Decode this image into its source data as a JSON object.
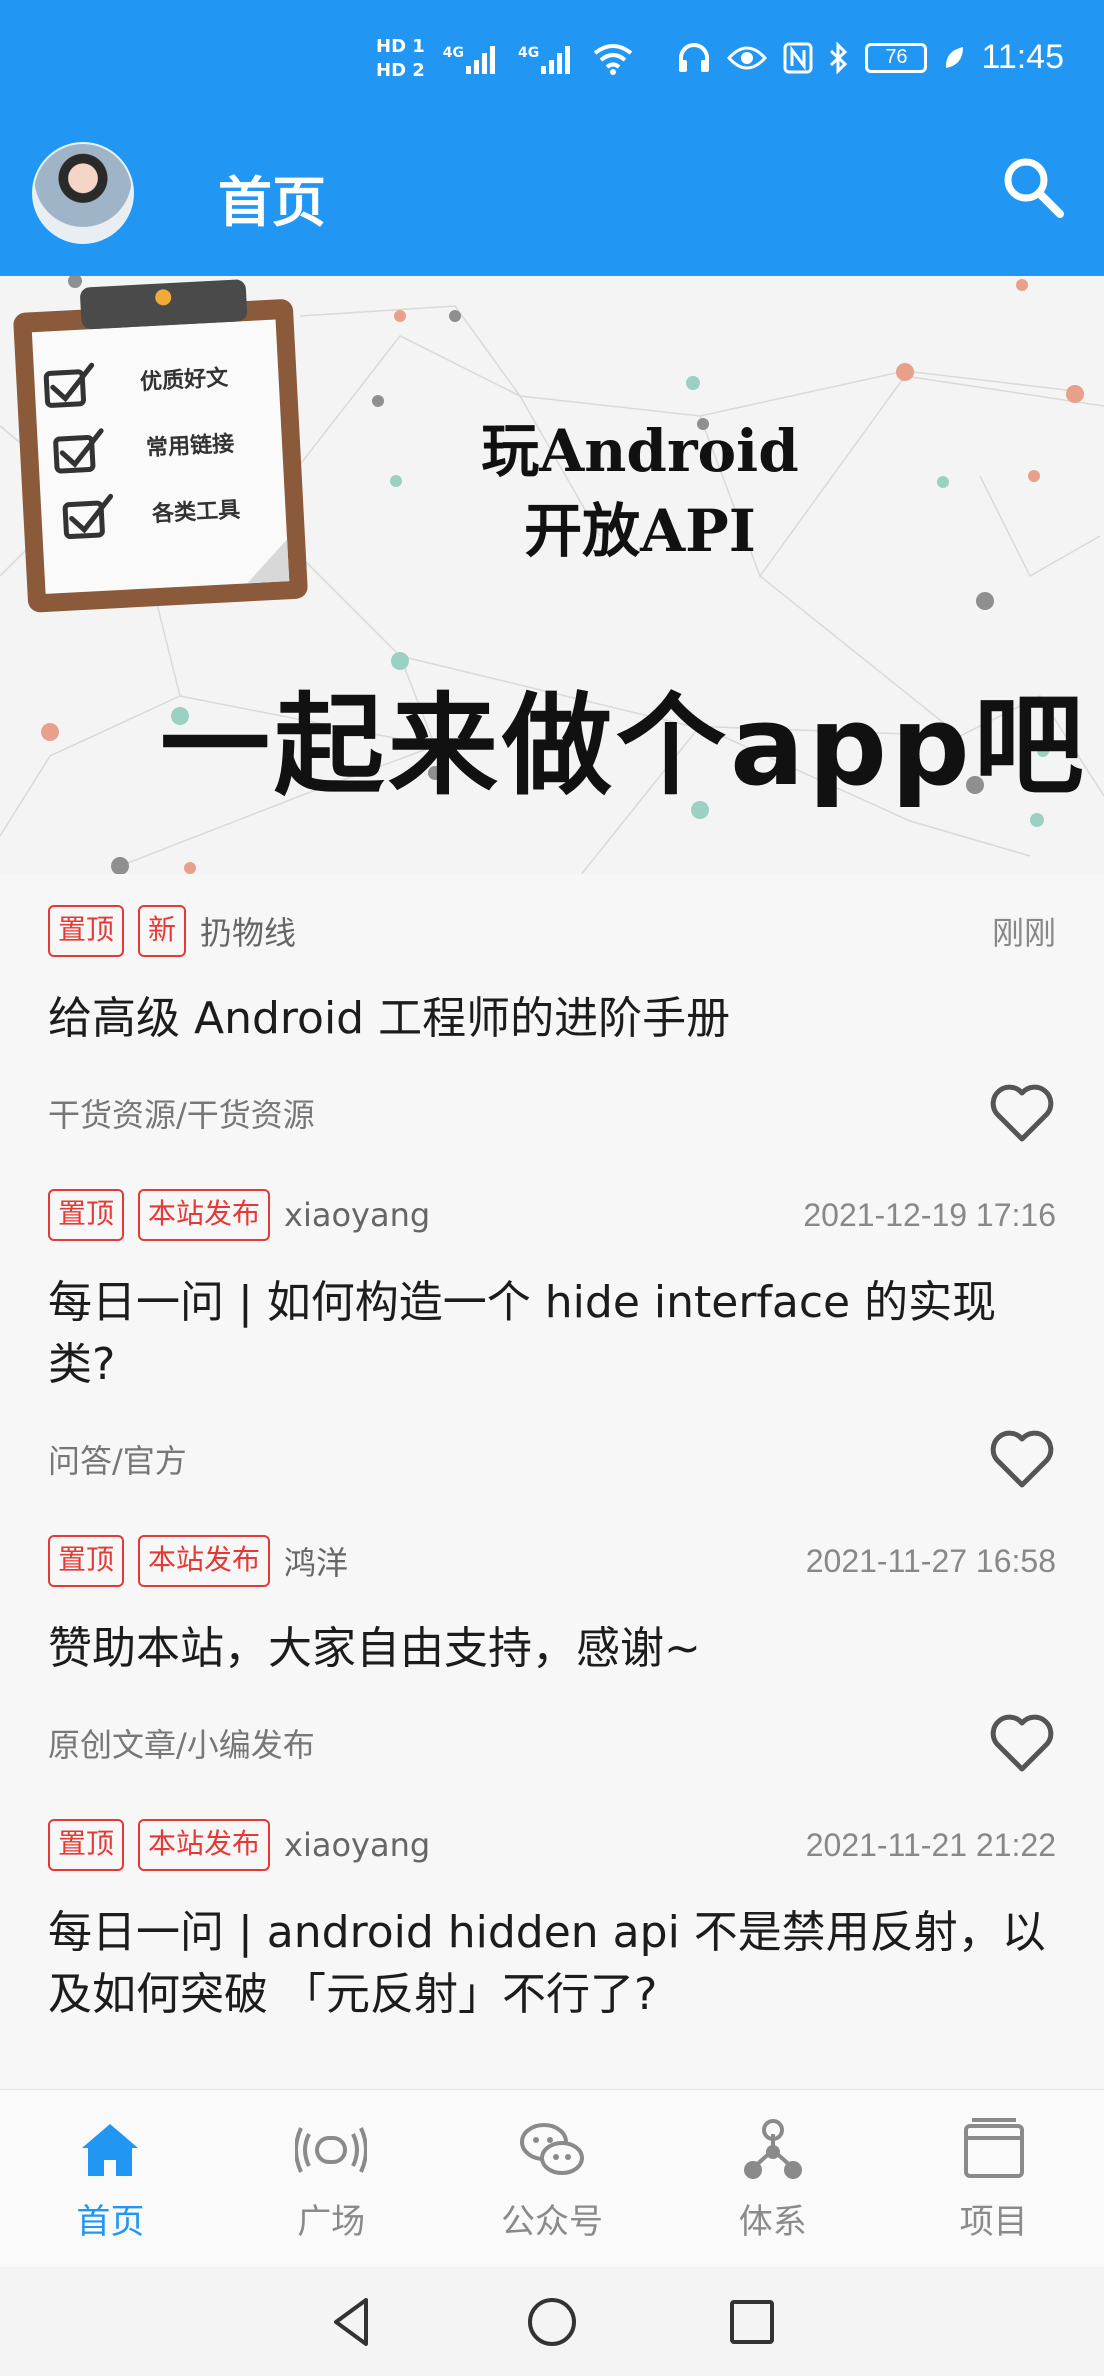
{
  "status": {
    "sim1": "HD 1",
    "sim2": "HD 2",
    "net1": "4G",
    "net2": "4G",
    "battery": "76",
    "time": "11:45"
  },
  "appbar": {
    "title": "首页"
  },
  "banner": {
    "title_line1": "玩Android",
    "title_line2": "开放API",
    "slogan": "一起来做个app吧",
    "checklist": [
      "优质好文",
      "常用链接",
      "各类工具"
    ]
  },
  "articles": [
    {
      "tags": [
        "置顶",
        "新"
      ],
      "author": "扔物线",
      "time": "刚刚",
      "title": "给高级 Android 工程师的进阶手册",
      "chapter": "干货资源/干货资源"
    },
    {
      "tags": [
        "置顶",
        "本站发布"
      ],
      "author": "xiaoyang",
      "time": "2021-12-19 17:16",
      "title": "每日一问 | 如何构造一个 hide interface 的实现类?",
      "chapter": "问答/官方"
    },
    {
      "tags": [
        "置顶",
        "本站发布"
      ],
      "author": "鸿洋",
      "time": "2021-11-27 16:58",
      "title": "赞助本站，大家自由支持，感谢~",
      "chapter": "原创文章/小编发布"
    },
    {
      "tags": [
        "置顶",
        "本站发布"
      ],
      "author": "xiaoyang",
      "time": "2021-11-21 21:22",
      "title": "每日一问 | android hidden api 不是禁用反射，以及如何突破 「元反射」不行了?",
      "chapter": ""
    }
  ],
  "bottomnav": [
    {
      "label": "首页",
      "icon": "home-icon",
      "active": true
    },
    {
      "label": "广场",
      "icon": "broadcast-icon",
      "active": false
    },
    {
      "label": "公众号",
      "icon": "wechat-icon",
      "active": false
    },
    {
      "label": "体系",
      "icon": "hierarchy-icon",
      "active": false
    },
    {
      "label": "项目",
      "icon": "project-icon",
      "active": false
    }
  ],
  "colors": {
    "primary": "#2196f3",
    "tag_red": "#e53935",
    "nav_inactive": "#8a8a8a"
  }
}
